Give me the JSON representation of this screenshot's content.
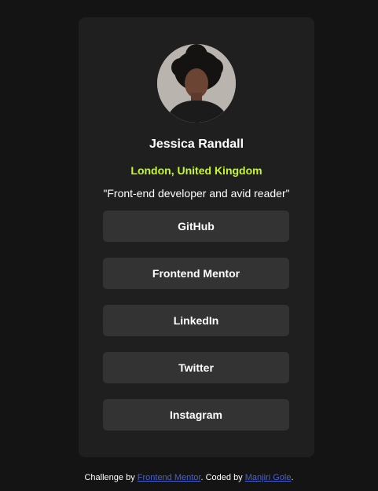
{
  "profile": {
    "name": "Jessica Randall",
    "location": "London, United Kingdom",
    "bio": "\"Front-end developer and avid reader\""
  },
  "links": [
    {
      "label": "GitHub"
    },
    {
      "label": "Frontend Mentor"
    },
    {
      "label": "LinkedIn"
    },
    {
      "label": "Twitter"
    },
    {
      "label": "Instagram"
    }
  ],
  "footer": {
    "prefix": "Challenge by ",
    "challenge_link": "Frontend Mentor",
    "middle": ". Coded by ",
    "author_link": "Manjiri Gole",
    "suffix": "."
  },
  "colors": {
    "background": "#141414",
    "card": "#1f1f1f",
    "button": "#333333",
    "accent": "#c4f82a",
    "footer_link": "#4a5fd1"
  }
}
